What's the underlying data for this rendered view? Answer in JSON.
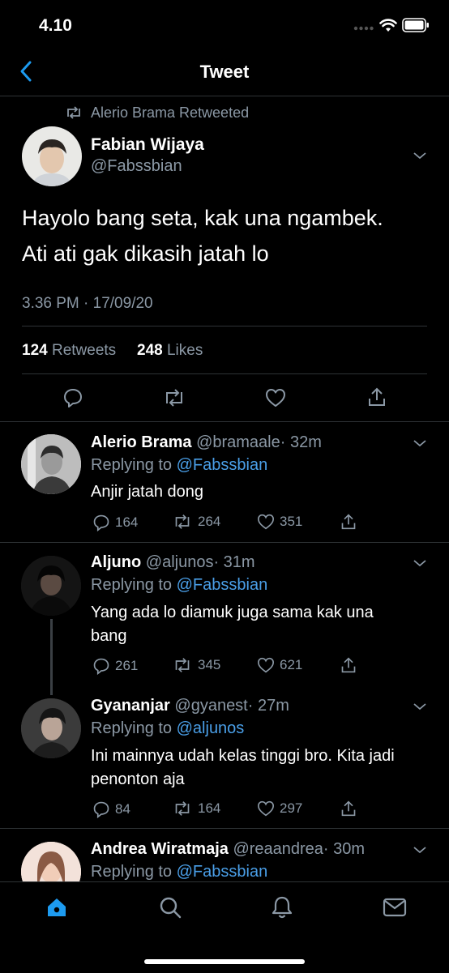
{
  "status_bar": {
    "time": "4.10"
  },
  "header": {
    "title": "Tweet",
    "back_icon": "chevron-left-icon"
  },
  "main_tweet": {
    "retweeted_by": "Alerio Brama Retweeted",
    "author_name": "Fabian Wijaya",
    "author_handle": "@Fabssbian",
    "text_line1": "Hayolo bang seta, kak una ngambek.",
    "text_line2": "Ati ati gak dikasih jatah lo",
    "timestamp": "3.36 PM · 17/09/20",
    "retweets_count": "124",
    "retweets_label": "Retweets",
    "likes_count": "248",
    "likes_label": "Likes"
  },
  "replies": [
    {
      "name": "Alerio Brama",
      "handle": "@bramaale",
      "time": "· 32m",
      "replying_label": "Replying to",
      "replying_to": "@Fabssbian",
      "text_line1": "Anjir jatah dong",
      "text_line2": "",
      "comments": "164",
      "retweets": "264",
      "likes": "351"
    },
    {
      "name": "Aljuno",
      "handle": "@aljunos",
      "time": "· 31m",
      "replying_label": "Replying to",
      "replying_to": "@Fabssbian",
      "text_line1": "Yang ada lo diamuk juga sama kak una",
      "text_line2": "bang",
      "comments": "261",
      "retweets": "345",
      "likes": "621"
    },
    {
      "name": "Gyananjar",
      "handle": "@gyanest",
      "time": "· 27m",
      "replying_label": "Replying to",
      "replying_to": "@aljunos",
      "text_line1": "Ini mainnya udah kelas tinggi bro. Kita jadi",
      "text_line2": "penonton aja",
      "comments": "84",
      "retweets": "164",
      "likes": "297"
    },
    {
      "name": "Andrea Wiratmaja",
      "handle": "@reaandrea",
      "time": "· 30m",
      "replying_label": "Replying to",
      "replying_to": "@Fabssbian",
      "text_line1": "",
      "text_line2": "",
      "comments": "",
      "retweets": "",
      "likes": ""
    }
  ],
  "tab_bar": {
    "items": [
      "home-icon",
      "search-icon",
      "notifications-icon",
      "messages-icon"
    ],
    "active_color": "#1d9bf0"
  }
}
